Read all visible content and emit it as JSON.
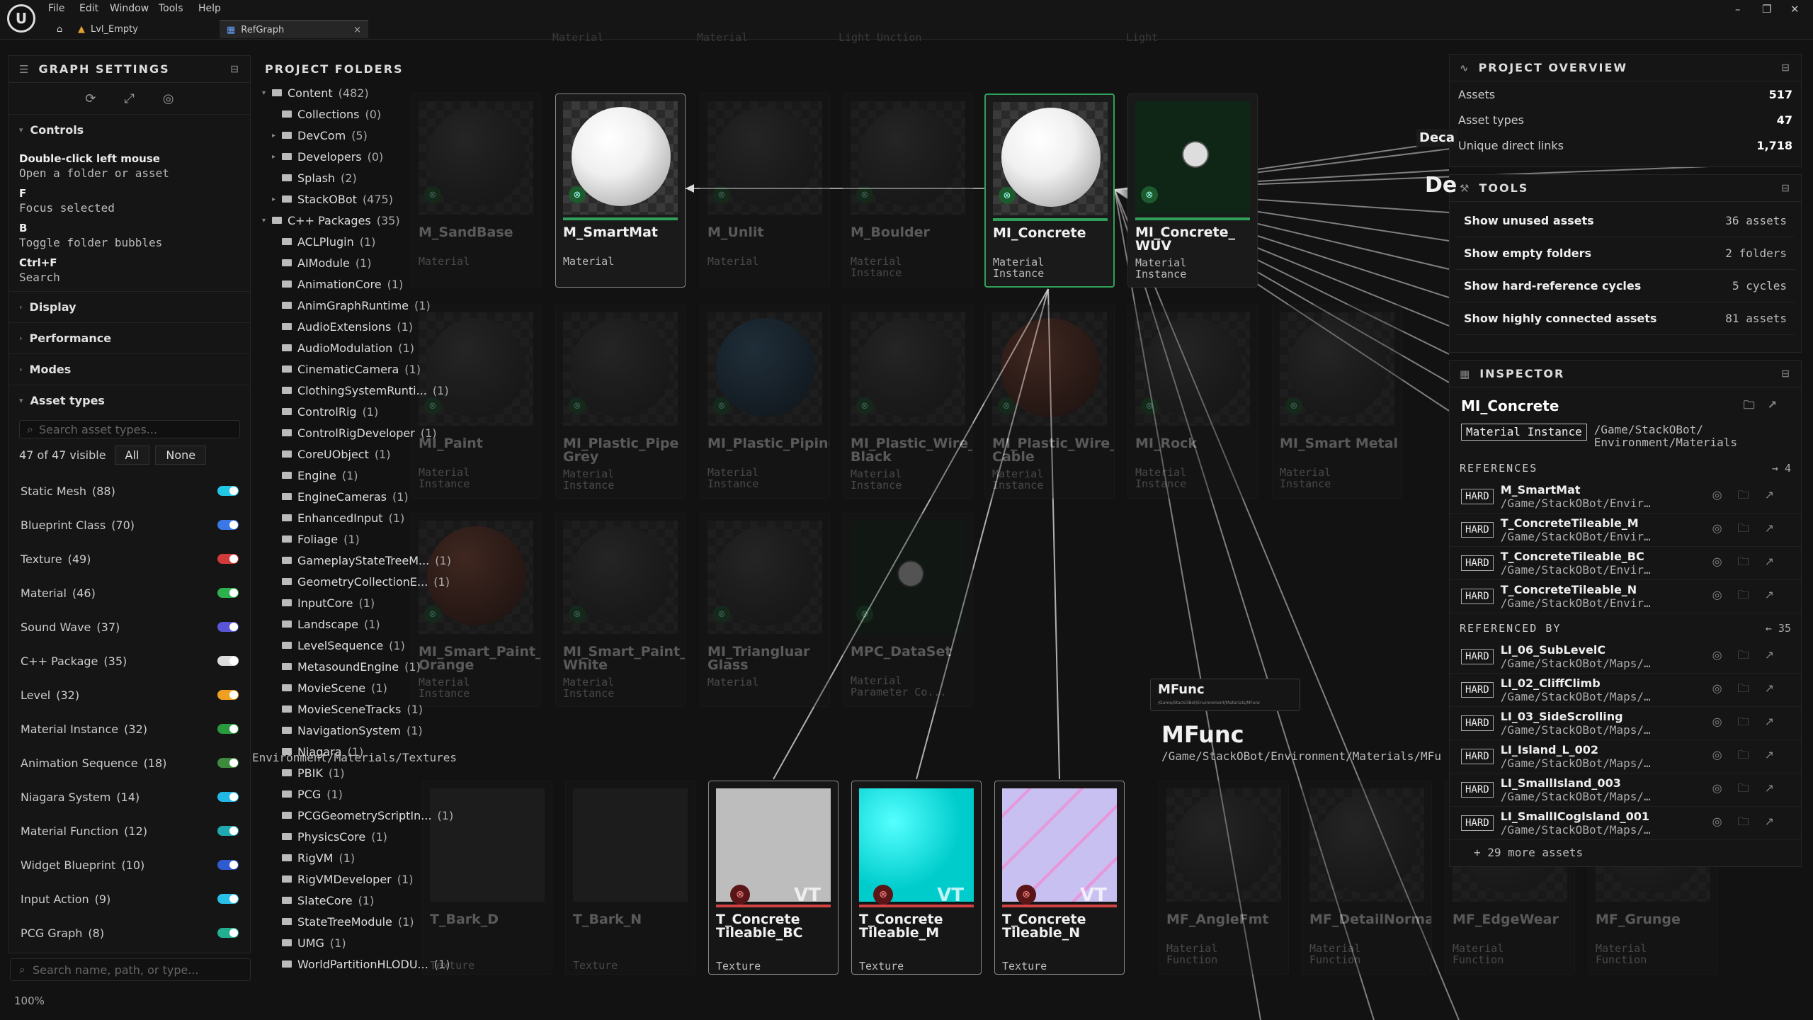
{
  "menu": [
    "File",
    "Edit",
    "Window",
    "Tools",
    "Help"
  ],
  "tabs": [
    {
      "label": "Lvl_Empty"
    },
    {
      "label": "RefGraph"
    }
  ],
  "settings": {
    "title": "GRAPH SETTINGS",
    "controls_label": "Controls",
    "controls": [
      {
        "key": "Double-click left mouse",
        "desc": "Open a folder or asset"
      },
      {
        "key": "F",
        "desc": "Focus selected"
      },
      {
        "key": "B",
        "desc": "Toggle folder bubbles"
      },
      {
        "key": "Ctrl+F",
        "desc": "Search"
      }
    ],
    "sections": [
      "Display",
      "Performance",
      "Modes",
      "Asset types"
    ],
    "asset_search_placeholder": "Search asset types...",
    "visible": "47 of 47 visible",
    "all": "All",
    "none": "None",
    "asset_types": [
      {
        "label": "Static Mesh",
        "count": "(88)",
        "color": "#22c7e6"
      },
      {
        "label": "Blueprint Class",
        "count": "(70)",
        "color": "#3a78e6"
      },
      {
        "label": "Texture",
        "count": "(49)",
        "color": "#d23b3b"
      },
      {
        "label": "Material",
        "count": "(46)",
        "color": "#2fb04e"
      },
      {
        "label": "Sound Wave",
        "count": "(37)",
        "color": "#5a55d6"
      },
      {
        "label": "C++ Package",
        "count": "(35)",
        "color": "#dcdcdc"
      },
      {
        "label": "Level",
        "count": "(32)",
        "color": "#f0a020"
      },
      {
        "label": "Material Instance",
        "count": "(32)",
        "color": "#2a9a3e"
      },
      {
        "label": "Animation Sequence",
        "count": "(18)",
        "color": "#3e8a3e"
      },
      {
        "label": "Niagara System",
        "count": "(14)",
        "color": "#22b8e6"
      },
      {
        "label": "Material Function",
        "count": "(12)",
        "color": "#22a8b0"
      },
      {
        "label": "Widget Blueprint",
        "count": "(10)",
        "color": "#2f5ad0"
      },
      {
        "label": "Input Action",
        "count": "(9)",
        "color": "#28c0e6"
      },
      {
        "label": "PCG Graph",
        "count": "(8)",
        "color": "#22b090"
      }
    ],
    "bottom_search": "Search name, path, or type...",
    "zoom": "100%"
  },
  "folders": {
    "title": "PROJECT FOLDERS",
    "items": [
      {
        "name": "Content",
        "count": "(482)",
        "depth": 0,
        "open": true
      },
      {
        "name": "Collections",
        "count": "(0)",
        "depth": 1
      },
      {
        "name": "DevCom",
        "count": "(5)",
        "depth": 1,
        "arrow": true
      },
      {
        "name": "Developers",
        "count": "(0)",
        "depth": 1,
        "arrow": true
      },
      {
        "name": "Splash",
        "count": "(2)",
        "depth": 1
      },
      {
        "name": "StackOBot",
        "count": "(475)",
        "depth": 1,
        "arrow": true
      },
      {
        "name": "C++ Packages",
        "count": "(35)",
        "depth": 0,
        "open": true
      },
      {
        "name": "ACLPlugin",
        "count": "(1)",
        "depth": 1
      },
      {
        "name": "AIModule",
        "count": "(1)",
        "depth": 1
      },
      {
        "name": "AnimationCore",
        "count": "(1)",
        "depth": 1
      },
      {
        "name": "AnimGraphRuntime",
        "count": "(1)",
        "depth": 1
      },
      {
        "name": "AudioExtensions",
        "count": "(1)",
        "depth": 1
      },
      {
        "name": "AudioModulation",
        "count": "(1)",
        "depth": 1
      },
      {
        "name": "CinematicCamera",
        "count": "(1)",
        "depth": 1
      },
      {
        "name": "ClothingSystemRunti...",
        "count": "(1)",
        "depth": 1
      },
      {
        "name": "ControlRig",
        "count": "(1)",
        "depth": 1
      },
      {
        "name": "ControlRigDeveloper",
        "count": "(1)",
        "depth": 1
      },
      {
        "name": "CoreUObject",
        "count": "(1)",
        "depth": 1
      },
      {
        "name": "Engine",
        "count": "(1)",
        "depth": 1
      },
      {
        "name": "EngineCameras",
        "count": "(1)",
        "depth": 1
      },
      {
        "name": "EnhancedInput",
        "count": "(1)",
        "depth": 1
      },
      {
        "name": "Foliage",
        "count": "(1)",
        "depth": 1
      },
      {
        "name": "GameplayStateTreeM...",
        "count": "(1)",
        "depth": 1
      },
      {
        "name": "GeometryCollectionE...",
        "count": "(1)",
        "depth": 1
      },
      {
        "name": "InputCore",
        "count": "(1)",
        "depth": 1
      },
      {
        "name": "Landscape",
        "count": "(1)",
        "depth": 1
      },
      {
        "name": "LevelSequence",
        "count": "(1)",
        "depth": 1
      },
      {
        "name": "MetasoundEngine",
        "count": "(1)",
        "depth": 1
      },
      {
        "name": "MovieScene",
        "count": "(1)",
        "depth": 1
      },
      {
        "name": "MovieSceneTracks",
        "count": "(1)",
        "depth": 1
      },
      {
        "name": "NavigationSystem",
        "count": "(1)",
        "depth": 1
      },
      {
        "name": "Niagara",
        "count": "(1)",
        "depth": 1
      },
      {
        "name": "PBIK",
        "count": "(1)",
        "depth": 1
      },
      {
        "name": "PCG",
        "count": "(1)",
        "depth": 1
      },
      {
        "name": "PCGGeometryScriptIn...",
        "count": "(1)",
        "depth": 1
      },
      {
        "name": "PhysicsCore",
        "count": "(1)",
        "depth": 1
      },
      {
        "name": "RigVM",
        "count": "(1)",
        "depth": 1
      },
      {
        "name": "RigVMDeveloper",
        "count": "(1)",
        "depth": 1
      },
      {
        "name": "SlateCore",
        "count": "(1)",
        "depth": 1
      },
      {
        "name": "StateTreeModule",
        "count": "(1)",
        "depth": 1
      },
      {
        "name": "UMG",
        "count": "(1)",
        "depth": 1
      },
      {
        "name": "WorldPartitionHLODU...",
        "count": "(1)",
        "depth": 1
      }
    ]
  },
  "graph": {
    "nodes": [
      {
        "name": "M_SmartMat",
        "type": "Material",
        "state": "hi",
        "sphere": "white"
      },
      {
        "name": "MI_Concrete",
        "type": "Material\nInstance",
        "state": "sel",
        "sphere": "white"
      },
      {
        "name": "MI_Concrete_\nWUV",
        "type": "Material\nInstance",
        "state": "plain",
        "sphere": "none"
      },
      {
        "name": "M_SandBase",
        "type": "Material",
        "state": "dim",
        "sphere": "dark"
      },
      {
        "name": "M_Unlit",
        "type": "Material",
        "state": "dim",
        "sphere": "dark"
      },
      {
        "name": "M_Boulder",
        "type": "Material\nInstance",
        "state": "dim",
        "sphere": "dark"
      },
      {
        "name": "MI_Paint",
        "type": "Material\nInstance",
        "state": "dim",
        "sphere": "dark"
      },
      {
        "name": "MI_Plastic_Pipe\nGrey",
        "type": "Material\nInstance",
        "state": "dim",
        "sphere": "dark"
      },
      {
        "name": "MI_Plastic_Piping",
        "type": "Material\nInstance",
        "state": "dim",
        "sphere": "blue"
      },
      {
        "name": "MI_Plastic_Wire_\nBlack",
        "type": "Material\nInstance",
        "state": "dim",
        "sphere": "dark"
      },
      {
        "name": "MI_Plastic_Wire_\nCable",
        "type": "Material\nInstance",
        "state": "dim",
        "sphere": "red"
      },
      {
        "name": "MI_Rock",
        "type": "Material\nInstance",
        "state": "dim",
        "sphere": "dark"
      },
      {
        "name": "MI_Smart Metal",
        "type": "Material\nInstance",
        "state": "dim",
        "sphere": "dark"
      },
      {
        "name": "MI_Smart_Paint_\nOrange",
        "type": "Material\nInstance",
        "state": "dim",
        "sphere": "red"
      },
      {
        "name": "MI_Smart_Paint_\nWhite",
        "type": "Material\nInstance",
        "state": "dim",
        "sphere": "dark"
      },
      {
        "name": "MI_Triangluar\nGlass",
        "type": "Material",
        "state": "dim",
        "sphere": "dark"
      },
      {
        "name": "MPC_DataSet",
        "type": "Material\nParameter Co...",
        "state": "dim",
        "sphere": "none"
      }
    ],
    "textures": [
      {
        "name": "T_Concrete\nTileable_BC",
        "type": "Texture",
        "bg": "#bdbdbd",
        "vt": "VT"
      },
      {
        "name": "T_Concrete\nTileable_M",
        "type": "Texture",
        "bg": "#22d8d8",
        "vt": "VT"
      },
      {
        "name": "T_Concrete\nTileable_N",
        "type": "Texture",
        "bg": "#c8c0f0",
        "vt": "VT"
      }
    ],
    "dim_textures": [
      {
        "name": "T_Bark_D",
        "type": "Texture"
      },
      {
        "name": "T_Bark_N",
        "type": "Texture"
      }
    ],
    "mfunc_nodes": [
      {
        "name": "MF_AngleFmt",
        "type": "Material\nFunction"
      },
      {
        "name": "MF_DetailNormal",
        "type": "Material\nFunction"
      },
      {
        "name": "MF_EdgeWear",
        "type": "Material\nFunction"
      },
      {
        "name": "MF_Grunge",
        "type": "Material\nFunction"
      }
    ],
    "textures_path": "Environment/Materials/Textures",
    "mfunc_small": "MFunc",
    "mfunc_small_path": "/Game/StackOBot/Environment/Materials/MFunc",
    "mfunc_big": "MFunc",
    "mfunc_big_path": "/Game/StackOBot/Environment/Materials/MFu",
    "decal_label": "Deca",
    "de_label": "De",
    "top_dim_labels": [
      "Material",
      "Material",
      "Light Unction",
      "Light"
    ]
  },
  "overview": {
    "title": "PROJECT OVERVIEW",
    "rows": [
      {
        "k": "Assets",
        "v": "517"
      },
      {
        "k": "Asset types",
        "v": "47"
      },
      {
        "k": "Unique direct links",
        "v": "1,718"
      }
    ]
  },
  "tools": {
    "title": "TOOLS",
    "rows": [
      {
        "k": "Show unused assets",
        "v": "36 assets"
      },
      {
        "k": "Show empty folders",
        "v": "2 folders"
      },
      {
        "k": "Show hard-reference cycles",
        "v": "5 cycles"
      },
      {
        "k": "Show highly connected assets",
        "v": "81 assets"
      }
    ]
  },
  "inspector": {
    "title": "INSPECTOR",
    "name": "MI_Concrete",
    "type": "Material Instance",
    "path": "/Game/StackOBot/\nEnvironment/Materials",
    "references_label": "REFERENCES",
    "references_count": "→ 4",
    "references": [
      {
        "tag": "HARD",
        "name": "M_SmartMat",
        "path": "/Game/StackOBot/Environme..."
      },
      {
        "tag": "HARD",
        "name": "T_ConcreteTileable_M",
        "path": "/Game/StackOBot/Environme..."
      },
      {
        "tag": "HARD",
        "name": "T_ConcreteTileable_BC",
        "path": "/Game/StackOBot/Environme..."
      },
      {
        "tag": "HARD",
        "name": "T_ConcreteTileable_N",
        "path": "/Game/StackOBot/Environme..."
      }
    ],
    "referenced_by_label": "REFERENCED BY",
    "referenced_by_count": "← 35",
    "referenced_by": [
      {
        "tag": "HARD",
        "name": "LI_06_SubLevelC",
        "path": "/Game/StackOBot/Maps/Leve..."
      },
      {
        "tag": "HARD",
        "name": "LI_02_CliffClimb",
        "path": "/Game/StackOBot/Maps/Leve..."
      },
      {
        "tag": "HARD",
        "name": "LI_03_SideScrolling",
        "path": "/Game/StackOBot/Maps/Leve..."
      },
      {
        "tag": "HARD",
        "name": "LI_Island_L_002",
        "path": "/Game/StackOBot/Maps/Leve..."
      },
      {
        "tag": "HARD",
        "name": "LI_SmallIsland_003",
        "path": "/Game/StackOBot/Maps/Leve..."
      },
      {
        "tag": "HARD",
        "name": "LI_SmallICogIsland_001",
        "path": "/Game/StackOBot/Maps/Leve..."
      }
    ],
    "more": "+ 29 more assets"
  },
  "colors": {
    "selected": "#2fa05a",
    "texture": "#d24242",
    "accent": "#2fa05a"
  }
}
